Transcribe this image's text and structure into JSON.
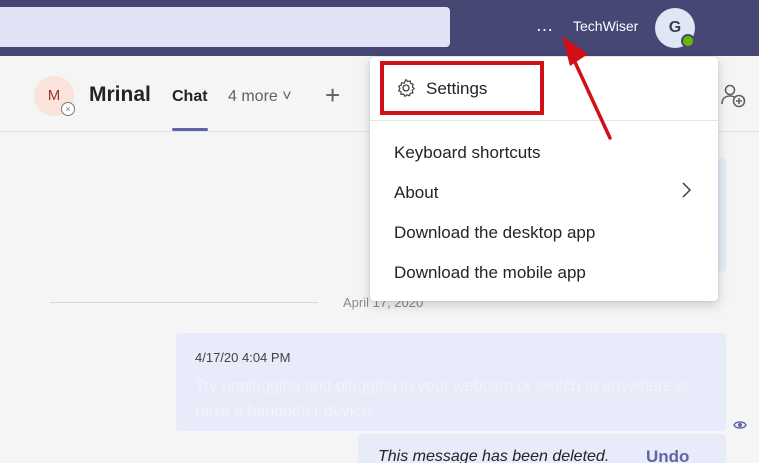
{
  "topbar": {
    "more_icon": "ellipsis-icon",
    "more_glyph": "…",
    "org_name": "TechWiser",
    "user_initial": "G",
    "presence": "available",
    "colors": {
      "bar": "#464775",
      "search": "#e2e2f6",
      "presence": "#6bb700"
    }
  },
  "chat_header": {
    "contact_initial": "M",
    "contact_name": "Mrinal",
    "tabs": [
      {
        "label": "Chat",
        "active": true
      },
      {
        "label": "4 more ˅"
      }
    ],
    "add_tab_glyph": "+",
    "accent": "#6264a7"
  },
  "menu": {
    "settings_label": "Settings",
    "items": [
      {
        "label": "Keyboard shortcuts"
      },
      {
        "label": "About",
        "has_submenu": true
      },
      {
        "label": "Download the desktop app"
      },
      {
        "label": "Download the mobile app"
      }
    ],
    "highlight_color": "#d00f17"
  },
  "messages": {
    "date_divider": "April 17, 2020",
    "message": {
      "timestamp": "4/17/20 4:04 PM",
      "text": "Try unplugging and plugging in your webcam or switch to anywhere is raise a handother device."
    },
    "deleted_notice": "This message has been deleted.",
    "undo_label": "Undo"
  },
  "annotation": {
    "arrow_color": "#d00f17"
  }
}
